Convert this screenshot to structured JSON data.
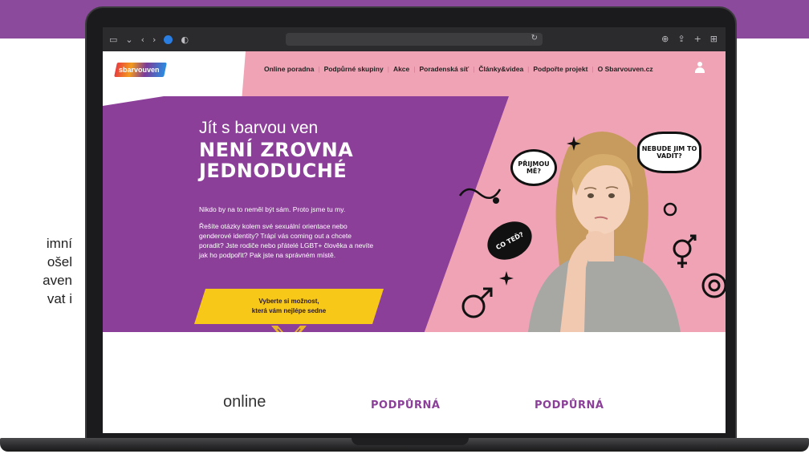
{
  "left_page_text": [
    "imní",
    "ošel",
    "aven",
    "vat i"
  ],
  "browser": {
    "icons": [
      "sidebar-icon",
      "chevron-down-icon",
      "back-icon",
      "forward-icon",
      "edge-icon",
      "shield-icon"
    ],
    "right_icons": [
      "download-icon",
      "share-icon",
      "plus-icon",
      "tabs-icon"
    ]
  },
  "site": {
    "logo_text": "sbarvouven",
    "nav": [
      "Online poradna",
      "Podpůrné skupiny",
      "Akce",
      "Poradenská síť",
      "Články&videa",
      "Podpořte projekt",
      "O Sbarvouven.cz"
    ],
    "hero": {
      "title_line1": "Jít s barvou ven",
      "title_line2": "NENÍ ZROVNA",
      "title_line3": "JEDNODUCHÉ",
      "subtitle": "Nikdo by na to neměl být sám. Proto jsme tu my.",
      "body": "Řešíte otázky kolem své sexuální orientace nebo genderové identity? Trápí vás coming out a chcete poradit? Jste rodiče nebo přátelé LGBT+ člověka a nevíte jak ho podpořit? Pak jste na správném místě.",
      "cta_line1": "Vyberte si možnost,",
      "cta_line2": "která vám nejlépe sedne"
    },
    "bubbles": {
      "b1": "PŘIJMOU MĚ?",
      "b2": "NEBUDE JIM TO VADIT?",
      "b3": "CO TEĎ?"
    },
    "services": [
      "online",
      "PODPŮRNÁ",
      "PODPŮRNÁ"
    ]
  },
  "colors": {
    "purple": "#8b3f99",
    "pink": "#f0a3b5",
    "yellow": "#f7c818"
  }
}
